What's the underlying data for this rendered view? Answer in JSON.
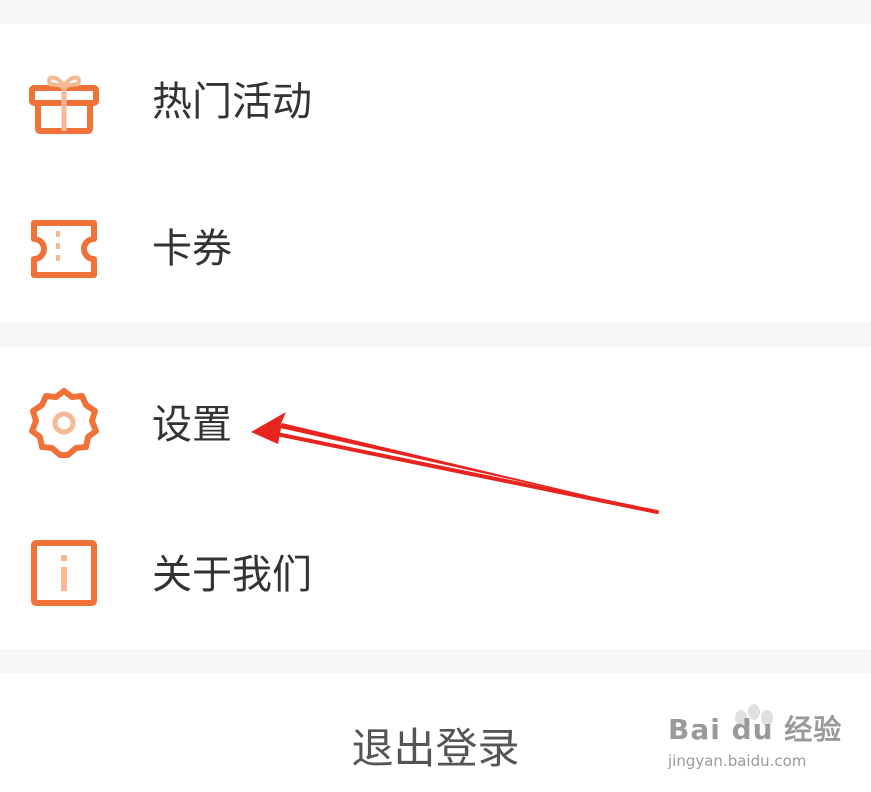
{
  "menu_group_1": {
    "items": [
      {
        "label": "热门活动",
        "icon": "gift-icon"
      },
      {
        "label": "卡券",
        "icon": "ticket-icon"
      }
    ]
  },
  "menu_group_2": {
    "items": [
      {
        "label": "设置",
        "icon": "gear-icon"
      },
      {
        "label": "关于我们",
        "icon": "info-icon"
      }
    ]
  },
  "logout": {
    "label": "退出登录"
  },
  "watermark": {
    "brand": "Bai du 经验",
    "url": "jingyan.baidu.com"
  },
  "annotation": {
    "icon": "red-arrow-icon",
    "color": "#e8241f",
    "points_to": "设置"
  },
  "colors": {
    "accent": "#f07238",
    "accent_light": "#f7b896",
    "text": "#333333",
    "background": "#f7f7f7"
  }
}
